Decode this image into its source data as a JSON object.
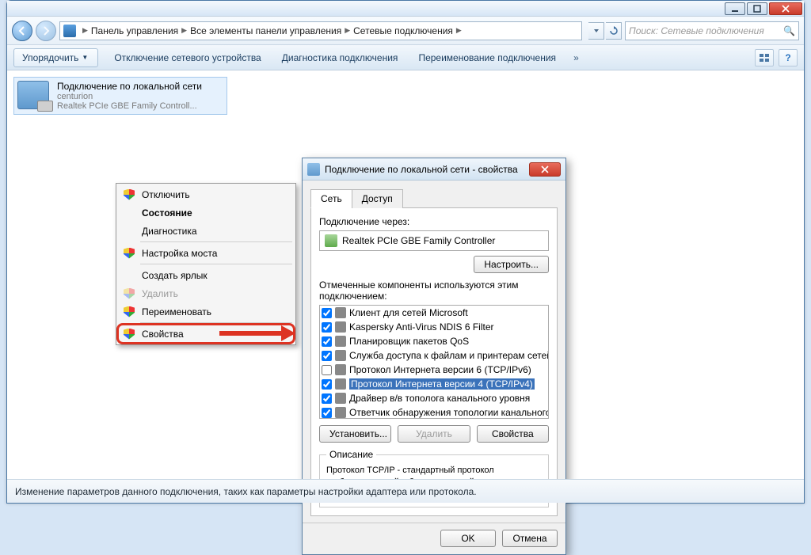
{
  "titlebar": {},
  "breadcrumb": {
    "segments": [
      "Панель управления",
      "Все элементы панели управления",
      "Сетевые подключения"
    ]
  },
  "search": {
    "placeholder": "Поиск: Сетевые подключения"
  },
  "cmdbar": {
    "organize": "Упорядочить",
    "items": [
      "Отключение сетевого устройства",
      "Диагностика подключения",
      "Переименование подключения"
    ]
  },
  "connection": {
    "title": "Подключение по локальной сети",
    "subtitle1": "centurion",
    "subtitle2": "Realtek PCIe GBE Family Controll..."
  },
  "context_menu": {
    "items": [
      {
        "label": "Отключить",
        "shield": true
      },
      {
        "label": "Состояние",
        "bold": true
      },
      {
        "label": "Диагностика"
      },
      {
        "sep": true
      },
      {
        "label": "Настройка моста",
        "shield": true
      },
      {
        "sep": true
      },
      {
        "label": "Создать ярлык"
      },
      {
        "label": "Удалить",
        "disabled": true,
        "shield": true
      },
      {
        "label": "Переименовать",
        "shield": true
      },
      {
        "sep": true
      },
      {
        "label": "Свойства",
        "shield": true,
        "highlighted": true
      }
    ]
  },
  "dialog": {
    "title": "Подключение по локальной сети - свойства",
    "tabs": {
      "network": "Сеть",
      "access": "Доступ"
    },
    "connect_via_label": "Подключение через:",
    "adapter": "Realtek PCIe GBE Family Controller",
    "configure_btn": "Настроить...",
    "components_label": "Отмеченные компоненты используются этим подключением:",
    "components": [
      {
        "checked": true,
        "label": "Клиент для сетей Microsoft"
      },
      {
        "checked": true,
        "label": "Kaspersky Anti-Virus NDIS 6 Filter"
      },
      {
        "checked": true,
        "label": "Планировщик пакетов QoS"
      },
      {
        "checked": true,
        "label": "Служба доступа к файлам и принтерам сетей Micro..."
      },
      {
        "checked": false,
        "label": "Протокол Интернета версии 6 (TCP/IPv6)"
      },
      {
        "checked": true,
        "label": "Протокол Интернета версии 4 (TCP/IPv4)",
        "selected": true
      },
      {
        "checked": true,
        "label": "Драйвер в/в тополога канального уровня"
      },
      {
        "checked": true,
        "label": "Ответчик обнаружения топологии канального уровня"
      }
    ],
    "install_btn": "Установить...",
    "uninstall_btn": "Удалить",
    "properties_btn": "Свойства",
    "desc_legend": "Описание",
    "desc_text": "Протокол TCP/IP - стандартный протокол глобальных сетей, обеспечивающий связь между различными взаимодействующими сетями.",
    "ok": "OK",
    "cancel": "Отмена"
  },
  "statusbar": "Изменение параметров данного подключения, таких как параметры настройки адаптера или протокола."
}
